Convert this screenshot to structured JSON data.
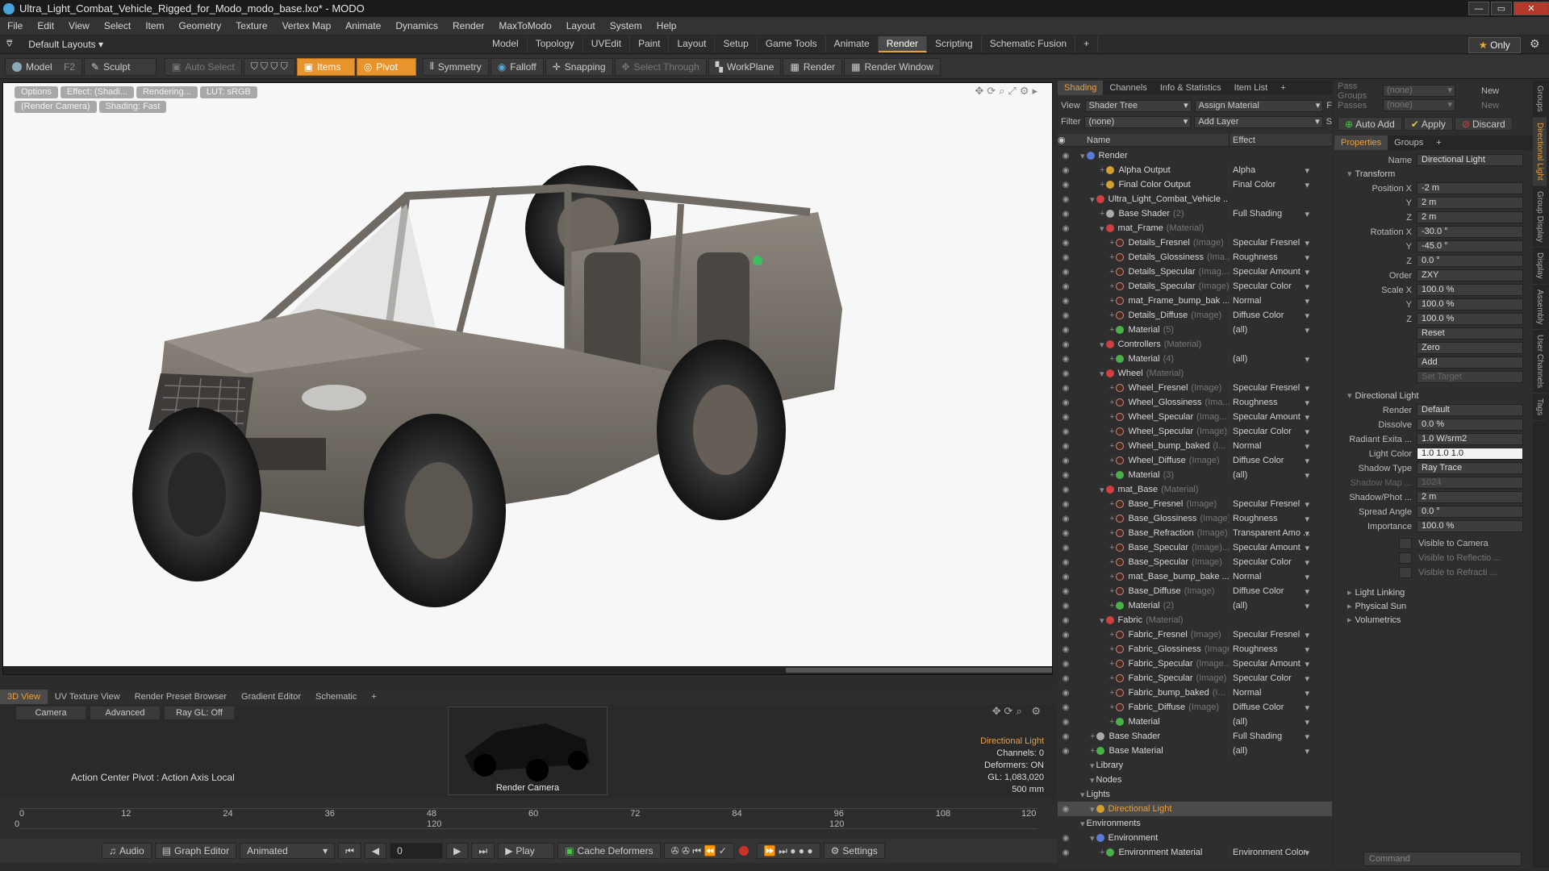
{
  "window": {
    "title": "Ultra_Light_Combat_Vehicle_Rigged_for_Modo_modo_base.lxo* - MODO"
  },
  "menu": [
    "File",
    "Edit",
    "View",
    "Select",
    "Item",
    "Geometry",
    "Texture",
    "Vertex Map",
    "Animate",
    "Dynamics",
    "Render",
    "MaxToModo",
    "Layout",
    "System",
    "Help"
  ],
  "layouts": {
    "default": "Default Layouts ▾",
    "tabs": [
      "Model",
      "Topology",
      "UVEdit",
      "Paint",
      "Layout",
      "Setup",
      "Game Tools",
      "Animate",
      "Render",
      "Scripting",
      "Schematic Fusion",
      "+"
    ],
    "active": "Render",
    "only": "Only"
  },
  "toolbar": {
    "model": "Model",
    "f2": "F2",
    "sculpt": "Sculpt",
    "auto_select": "Auto Select",
    "items": "Items",
    "pivot": "Pivot",
    "symmetry": "Symmetry",
    "falloff": "Falloff",
    "snapping": "Snapping",
    "select_through": "Select Through",
    "workplane": "WorkPlane",
    "render": "Render",
    "render_window": "Render Window"
  },
  "viewport": {
    "chips": [
      "Options",
      "Effect: (Shadi...",
      "Rendering...",
      "LUT: sRGB",
      "(Render Camera)",
      "Shading: Fast"
    ]
  },
  "bottom_tabs": [
    "3D View",
    "UV Texture View",
    "Render Preset Browser",
    "Gradient Editor",
    "Schematic",
    "+"
  ],
  "mini": {
    "camera": "Camera",
    "advanced": "Advanced",
    "raygl": "Ray GL: Off",
    "action": "Action Center Pivot : Action Axis Local",
    "render_camera": "Render Camera",
    "stats": {
      "item": "Directional Light",
      "channels": "Channels: 0",
      "deformers": "Deformers: ON",
      "gl": "GL: 1,083,020",
      "size": "500 mm"
    }
  },
  "timeline": {
    "ticks": [
      "0",
      "12",
      "24",
      "36",
      "48",
      "60",
      "72",
      "84",
      "96",
      "108",
      "120"
    ],
    "subticks": [
      "0",
      "120",
      "120"
    ]
  },
  "playbar": {
    "audio": "Audio",
    "graph": "Graph Editor",
    "mode": "Animated",
    "frame": "0",
    "play": "Play",
    "cache": "Cache Deformers",
    "settings": "Settings"
  },
  "shading": {
    "tabs": [
      "Shading",
      "Channels",
      "Info & Statistics",
      "Item List",
      "+"
    ],
    "view_label": "View",
    "view_value": "Shader Tree",
    "assign": "Assign Material",
    "f": "F",
    "filter_label": "Filter",
    "filter_value": "(none)",
    "add_layer": "Add Layer",
    "s": "S",
    "col_name": "Name",
    "col_effect": "Effect",
    "rows": [
      {
        "n": "Render",
        "s": "",
        "e": "",
        "b": "blu",
        "i": 0
      },
      {
        "n": "Alpha Output",
        "s": "",
        "e": "Alpha",
        "b": "yel",
        "i": 2
      },
      {
        "n": "Final Color Output",
        "s": "",
        "e": "Final Color",
        "b": "yel",
        "i": 2
      },
      {
        "n": "Ultra_Light_Combat_Vehicle ...",
        "s": "",
        "e": "",
        "b": "mat",
        "i": 1
      },
      {
        "n": "Base Shader",
        "s": "(2)",
        "e": "Full Shading",
        "b": "gry",
        "i": 2
      },
      {
        "n": "mat_Frame",
        "s": "(Material)",
        "e": "",
        "b": "mat",
        "i": 2
      },
      {
        "n": "Details_Fresnel",
        "s": "(Image)",
        "e": "Specular Fresnel",
        "b": "img",
        "i": 3
      },
      {
        "n": "Details_Glossiness",
        "s": "(Ima...",
        "e": "Roughness",
        "b": "img",
        "i": 3
      },
      {
        "n": "Details_Specular",
        "s": "(Imag...",
        "e": "Specular Amount",
        "b": "img",
        "i": 3
      },
      {
        "n": "Details_Specular",
        "s": "(Image)",
        "e": "Specular Color",
        "b": "img",
        "i": 3
      },
      {
        "n": "mat_Frame_bump_bak ...",
        "s": "",
        "e": "Normal",
        "b": "img",
        "i": 3
      },
      {
        "n": "Details_Diffuse",
        "s": "(Image)",
        "e": "Diffuse Color",
        "b": "img",
        "i": 3
      },
      {
        "n": "Material",
        "s": "(5)",
        "e": "(all)",
        "b": "grn",
        "i": 3
      },
      {
        "n": "Controllers",
        "s": "(Material)",
        "e": "",
        "b": "mat",
        "i": 2
      },
      {
        "n": "Material",
        "s": "(4)",
        "e": "(all)",
        "b": "grn",
        "i": 3
      },
      {
        "n": "Wheel",
        "s": "(Material)",
        "e": "",
        "b": "mat",
        "i": 2
      },
      {
        "n": "Wheel_Fresnel",
        "s": "(Image)",
        "e": "Specular Fresnel",
        "b": "img",
        "i": 3
      },
      {
        "n": "Wheel_Glossiness",
        "s": "(Ima...",
        "e": "Roughness",
        "b": "img",
        "i": 3
      },
      {
        "n": "Wheel_Specular",
        "s": "(Imag...",
        "e": "Specular Amount",
        "b": "img",
        "i": 3
      },
      {
        "n": "Wheel_Specular",
        "s": "(Image)",
        "e": "Specular Color",
        "b": "img",
        "i": 3
      },
      {
        "n": "Wheel_bump_baked",
        "s": "(I...",
        "e": "Normal",
        "b": "img",
        "i": 3
      },
      {
        "n": "Wheel_Diffuse",
        "s": "(Image)",
        "e": "Diffuse Color",
        "b": "img",
        "i": 3
      },
      {
        "n": "Material",
        "s": "(3)",
        "e": "(all)",
        "b": "grn",
        "i": 3
      },
      {
        "n": "mat_Base",
        "s": "(Material)",
        "e": "",
        "b": "mat",
        "i": 2
      },
      {
        "n": "Base_Fresnel",
        "s": "(Image)",
        "e": "Specular Fresnel",
        "b": "img",
        "i": 3
      },
      {
        "n": "Base_Glossiness",
        "s": "(Image)",
        "e": "Roughness",
        "b": "img",
        "i": 3
      },
      {
        "n": "Base_Refraction",
        "s": "(Image)",
        "e": "Transparent Amo ...",
        "b": "img",
        "i": 3
      },
      {
        "n": "Base_Specular",
        "s": "(Image)...",
        "e": "Specular Amount",
        "b": "img",
        "i": 3
      },
      {
        "n": "Base_Specular",
        "s": "(Image)",
        "e": "Specular Color",
        "b": "img",
        "i": 3
      },
      {
        "n": "mat_Base_bump_bake ...",
        "s": "",
        "e": "Normal",
        "b": "img",
        "i": 3
      },
      {
        "n": "Base_Diffuse",
        "s": "(Image)",
        "e": "Diffuse Color",
        "b": "img",
        "i": 3
      },
      {
        "n": "Material",
        "s": "(2)",
        "e": "(all)",
        "b": "grn",
        "i": 3
      },
      {
        "n": "Fabric",
        "s": "(Material)",
        "e": "",
        "b": "mat",
        "i": 2
      },
      {
        "n": "Fabric_Fresnel",
        "s": "(Image)",
        "e": "Specular Fresnel",
        "b": "img",
        "i": 3
      },
      {
        "n": "Fabric_Glossiness",
        "s": "(Image)",
        "e": "Roughness",
        "b": "img",
        "i": 3
      },
      {
        "n": "Fabric_Specular",
        "s": "(Image...",
        "e": "Specular Amount",
        "b": "img",
        "i": 3
      },
      {
        "n": "Fabric_Specular",
        "s": "(Image)",
        "e": "Specular Color",
        "b": "img",
        "i": 3
      },
      {
        "n": "Fabric_bump_baked",
        "s": "(I...",
        "e": "Normal",
        "b": "img",
        "i": 3
      },
      {
        "n": "Fabric_Diffuse",
        "s": "(Image)",
        "e": "Diffuse Color",
        "b": "img",
        "i": 3
      },
      {
        "n": "Material",
        "s": "",
        "e": "(all)",
        "b": "grn",
        "i": 3
      },
      {
        "n": "Base Shader",
        "s": "",
        "e": "Full Shading",
        "b": "gry",
        "i": 1
      },
      {
        "n": "Base Material",
        "s": "",
        "e": "(all)",
        "b": "grn",
        "i": 1
      },
      {
        "n": "Library",
        "s": "",
        "e": "",
        "b": "",
        "i": 1
      },
      {
        "n": "Nodes",
        "s": "",
        "e": "",
        "b": "",
        "i": 1
      },
      {
        "n": "Lights",
        "s": "",
        "e": "",
        "b": "",
        "i": 0
      },
      {
        "n": "Directional Light",
        "s": "",
        "e": "",
        "b": "yel",
        "i": 1,
        "sel": true
      },
      {
        "n": "Environments",
        "s": "",
        "e": "",
        "b": "",
        "i": 0
      },
      {
        "n": "Environment",
        "s": "",
        "e": "",
        "b": "blu",
        "i": 1
      },
      {
        "n": "Environment Material",
        "s": "",
        "e": "Environment Color",
        "b": "grn",
        "i": 2
      }
    ]
  },
  "props": {
    "pass_groups": "Pass Groups",
    "none1": "(none)",
    "new1": "New",
    "passes": "Passes",
    "none2": "(none)",
    "new2": "New",
    "auto_add": "Auto Add",
    "apply": "Apply",
    "discard": "Discard",
    "tabs": [
      "Properties",
      "Groups",
      "+"
    ],
    "name_label": "Name",
    "name_value": "Directional Light",
    "transform": "Transform",
    "fields": [
      {
        "l": "Position X",
        "v": "-2 m"
      },
      {
        "l": "Y",
        "v": "2 m"
      },
      {
        "l": "Z",
        "v": "2 m"
      },
      {
        "l": "Rotation X",
        "v": "-30.0 °"
      },
      {
        "l": "Y",
        "v": "-45.0 °"
      },
      {
        "l": "Z",
        "v": "0.0 °"
      },
      {
        "l": "Order",
        "v": "ZXY"
      },
      {
        "l": "Scale X",
        "v": "100.0 %"
      },
      {
        "l": "Y",
        "v": "100.0 %"
      },
      {
        "l": "Z",
        "v": "100.0 %"
      },
      {
        "l": "",
        "v": "Reset"
      },
      {
        "l": "",
        "v": "Zero"
      },
      {
        "l": "",
        "v": "Add"
      },
      {
        "l": "",
        "v": "Set Target"
      }
    ],
    "dir_light": "Directional Light",
    "dl_fields": [
      {
        "l": "Render",
        "v": "Default"
      },
      {
        "l": "Dissolve",
        "v": "0.0 %"
      },
      {
        "l": "Radiant Exita ...",
        "v": "1.0 W/srm2"
      },
      {
        "l": "Light Color",
        "v": "1.0    1.0    1.0"
      },
      {
        "l": "Shadow Type",
        "v": "Ray Trace"
      },
      {
        "l": "Shadow Map ...",
        "v": "1024"
      },
      {
        "l": "Shadow/Phot ...",
        "v": "2 m"
      },
      {
        "l": "Spread Angle",
        "v": "0.0 °"
      },
      {
        "l": "Importance",
        "v": "100.0 %"
      }
    ],
    "checks": [
      "Visible to Camera",
      "Visible to Reflectio ...",
      "Visible to Refracti ..."
    ],
    "closed": [
      "Light Linking",
      "Physical Sun",
      "Volumetrics"
    ],
    "command": "Command"
  },
  "vtabs": [
    "Groups",
    "Directional Light",
    "Group Display",
    "Display",
    "Assembly",
    "User Channels",
    "Tags"
  ]
}
